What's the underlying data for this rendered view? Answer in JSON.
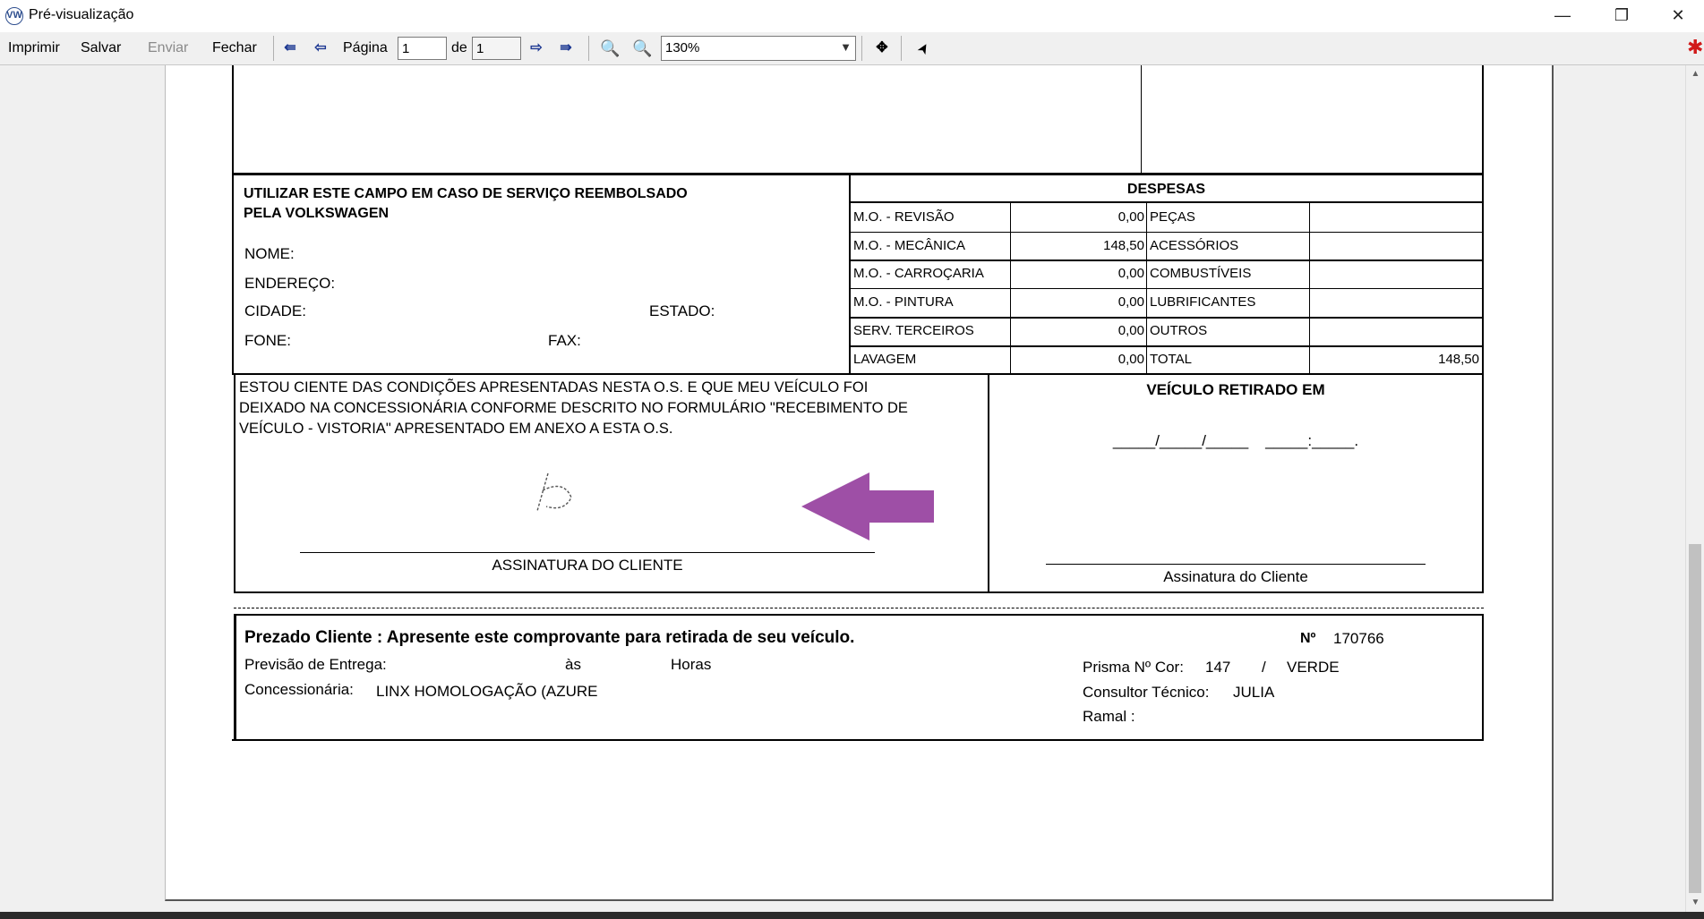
{
  "window": {
    "title": "Pré-visualização",
    "app_icon": "VW",
    "minimize": "—",
    "restore": "❐",
    "close": "✕"
  },
  "toolbar": {
    "print": "Imprimir",
    "save": "Salvar",
    "send": "Enviar",
    "close": "Fechar",
    "page_label": "Página",
    "page_value": "1",
    "of_label": "de",
    "total_pages": "1",
    "zoom": "130%"
  },
  "icons": {
    "first": "⇚",
    "prev": "⇦",
    "next": "⇨",
    "last": "⇛",
    "zoom_out": "🔍",
    "zoom_in": "🔍",
    "pan": "✥",
    "pointer": "➤",
    "dropdown": "▼",
    "bug": "✱",
    "scroll_up": "▲",
    "scroll_down": "▼"
  },
  "colors": {
    "arrow": "#9e4fa6",
    "toolbar_bg": "#f0f0f0"
  },
  "form": {
    "reimb_title1": "UTILIZAR ESTE CAMPO EM CASO DE SERVIÇO REEMBOLSADO",
    "reimb_title2": "PELA VOLKSWAGEN",
    "nome": "NOME:",
    "endereco": "ENDEREÇO:",
    "cidade": "CIDADE:",
    "estado": "ESTADO:",
    "fone": "FONE:",
    "fax": "FAX:",
    "despesas_title": "DESPESAS",
    "despesas_rows": [
      {
        "label": "M.O. - REVISÃO",
        "value": "0,00",
        "label2": "PEÇAS",
        "value2": ""
      },
      {
        "label": "M.O. - MECÂNICA",
        "value": "148,50",
        "label2": "ACESSÓRIOS",
        "value2": ""
      },
      {
        "label": "M.O. - CARROÇARIA",
        "value": "0,00",
        "label2": "COMBUSTÍVEIS",
        "value2": ""
      },
      {
        "label": "M.O. - PINTURA",
        "value": "0,00",
        "label2": "LUBRIFICANTES",
        "value2": ""
      },
      {
        "label": "SERV. TERCEIROS",
        "value": "0,00",
        "label2": "OUTROS",
        "value2": ""
      },
      {
        "label": "LAVAGEM",
        "value": "0,00",
        "label2": "TOTAL",
        "value2": "148,50"
      }
    ],
    "terms1": "ESTOU CIENTE DAS CONDIÇÕES APRESENTADAS NESTA O.S. E QUE MEU VEÍCULO FOI",
    "terms2": "DEIXADO NA CONCESSIONÁRIA CONFORME DESCRITO NO FORMULÁRIO \"RECEBIMENTO DE",
    "terms3": "VEÍCULO - VISTORIA\" APRESENTADO EM ANEXO A ESTA O.S.",
    "signature_label": "ASSINATURA DO CLIENTE",
    "vehicle_title": "VEÍCULO RETIRADO EM",
    "vehicle_date": "_____/_____/_____    _____:_____.",
    "vehicle_sign": "Assinatura do Cliente",
    "receipt_title": "Prezado Cliente : Apresente este comprovante para retirada de seu veículo.",
    "number_label": "Nº",
    "number_value": "170766",
    "delivery_label": "Previsão de Entrega:",
    "as_label": "às",
    "hours_label": "Horas",
    "dealer_label": "Concessionária:",
    "dealer_value": "LINX HOMOLOGAÇÃO (AZURE",
    "prisma_label": "Prisma Nº Cor:",
    "prisma_value": "147",
    "color_sep": "/",
    "color_value": "VERDE",
    "consultant_label": "Consultor Técnico:",
    "consultant_value": "JULIA",
    "ramal_label": "Ramal :"
  }
}
